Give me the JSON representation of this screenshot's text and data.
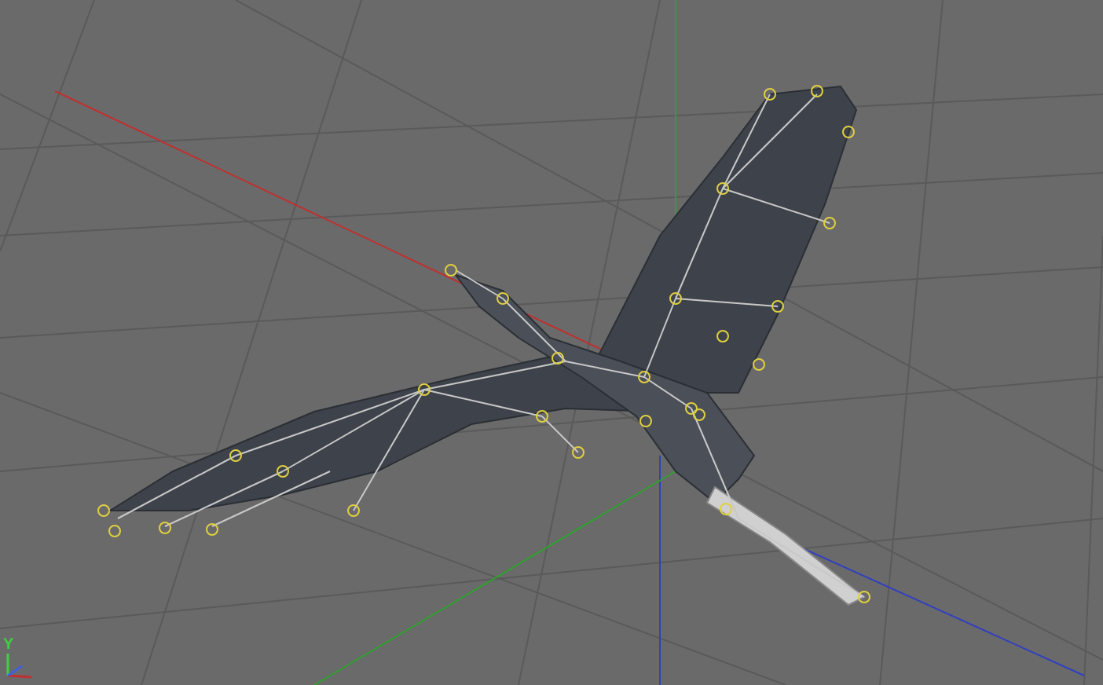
{
  "viewport": {
    "axis_gizmo": {
      "y_label": "Y"
    }
  }
}
